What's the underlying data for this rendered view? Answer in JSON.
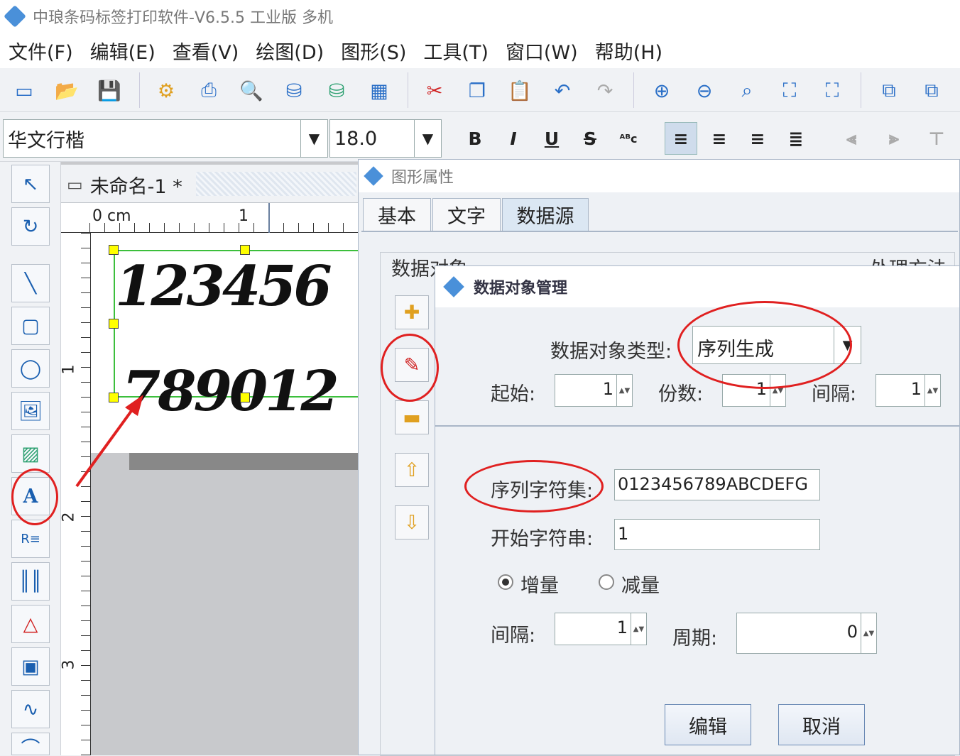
{
  "window": {
    "title": "中琅条码标签打印软件-V6.5.5 工业版 多机"
  },
  "menu": [
    "文件(F)",
    "编辑(E)",
    "查看(V)",
    "绘图(D)",
    "图形(S)",
    "工具(T)",
    "窗口(W)",
    "帮助(H)"
  ],
  "font": {
    "family": "华文行楷",
    "size": "18.0"
  },
  "document": {
    "tab_title": "未命名-1 *",
    "ruler_unit": "0 cm",
    "ruler_top": [
      "1"
    ],
    "ruler_left": [
      "1",
      "2",
      "3"
    ],
    "text_line1": "123456",
    "text_line2": "789012"
  },
  "properties": {
    "title": "图形属性",
    "tabs": [
      "基本",
      "文字",
      "数据源"
    ],
    "active_tab": "数据源",
    "group_label": "数据对象",
    "right_label": "处理方法"
  },
  "dialog": {
    "title": "数据对象管理",
    "type_label": "数据对象类型:",
    "type_value": "序列生成",
    "start_label": "起始:",
    "start_value": "1",
    "copies_label": "份数:",
    "copies_value": "1",
    "interval_label": "间隔:",
    "interval_value": "1",
    "charset_label": "序列字符集:",
    "charset_value": "0123456789ABCDEFG",
    "start_str_label": "开始字符串:",
    "start_str_value": "1",
    "increase_label": "增量",
    "decrease_label": "减量",
    "interval2_label": "间隔:",
    "interval2_value": "1",
    "period_label": "周期:",
    "period_value": "0",
    "edit_button": "编辑",
    "cancel_button": "取消"
  },
  "colors": {
    "annotation": "#e02020",
    "accent": "#1a5fb0"
  }
}
